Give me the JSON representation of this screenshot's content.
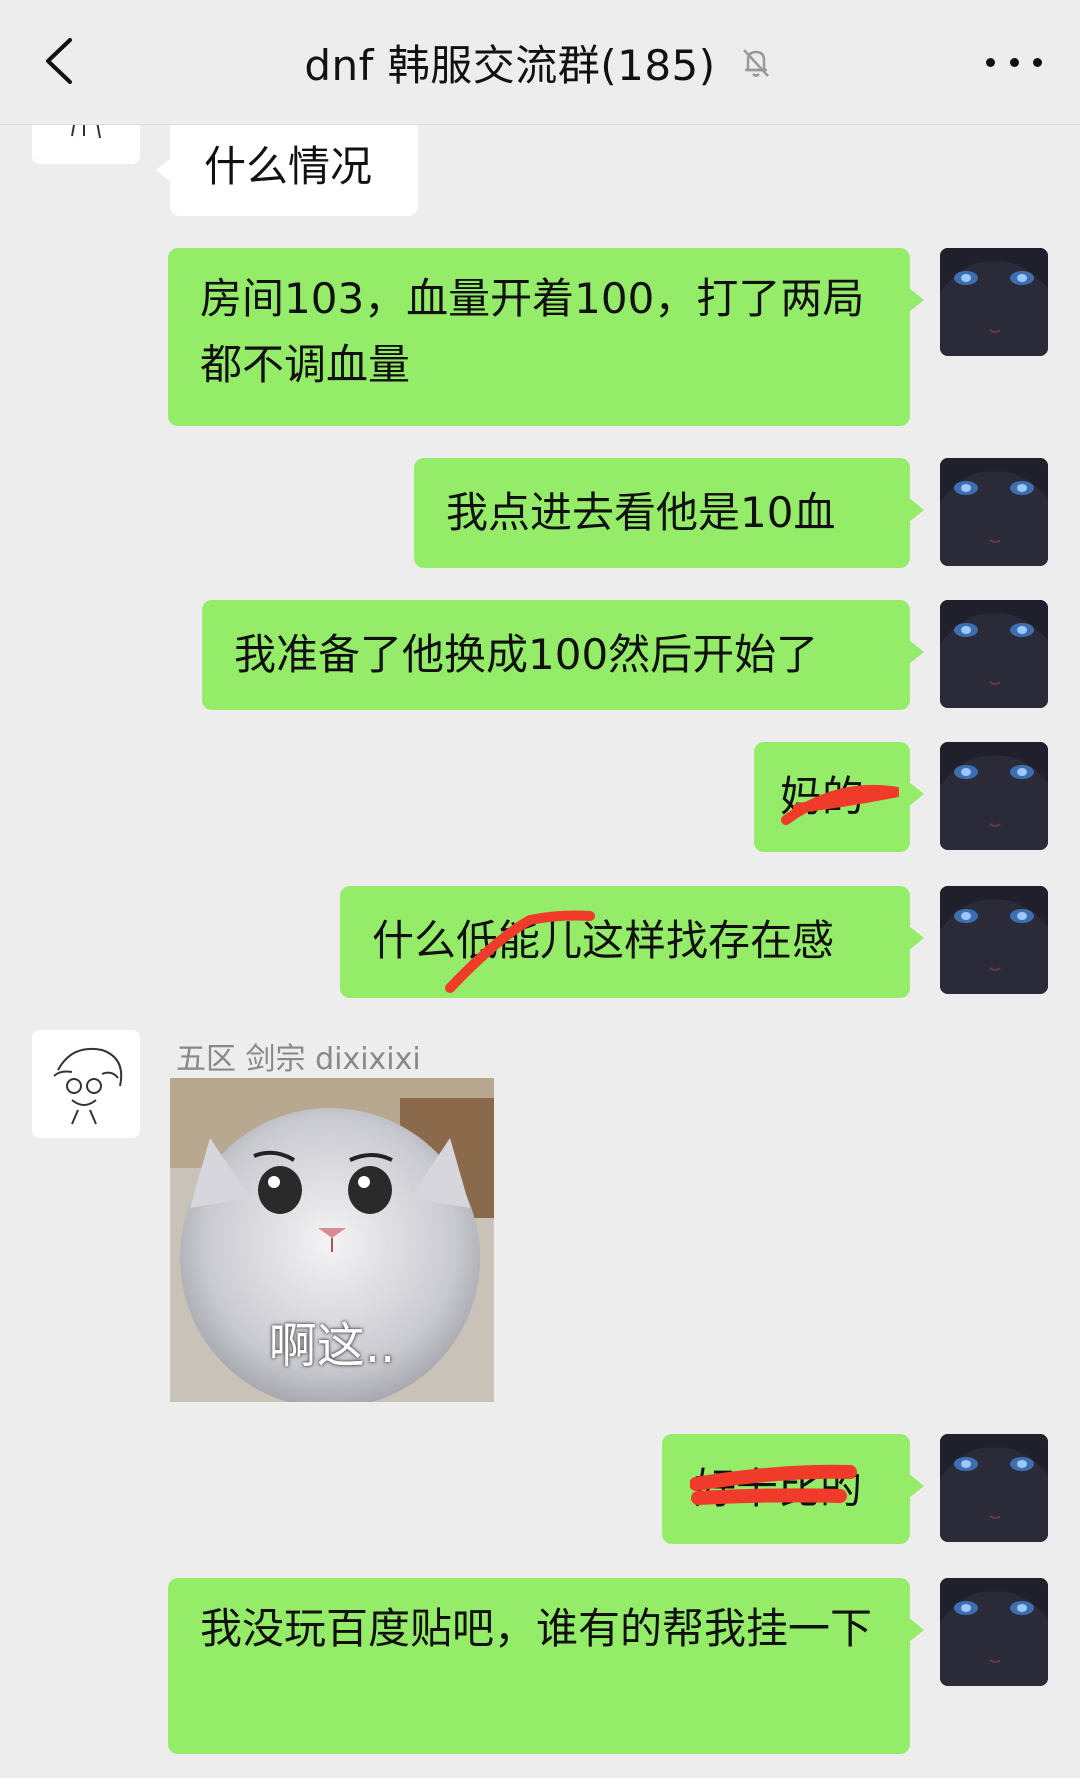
{
  "header": {
    "back_icon": "chevron-left-icon",
    "title": "dnf 韩服交流群(185)",
    "mute_icon": "bell-off-icon",
    "more_icon": "more-dots-icon"
  },
  "messages": [
    {
      "side": "other",
      "text": "什么情况"
    },
    {
      "side": "me",
      "text": "房间103，血量开着100，打了两局都不调血量"
    },
    {
      "side": "me",
      "text": "我点进去看他是10血"
    },
    {
      "side": "me",
      "text": "我准备了他换成100然后开始了"
    },
    {
      "side": "me",
      "text": "妈的",
      "redacted": true
    },
    {
      "side": "me",
      "text": "什么低能儿这样找存在感",
      "redacted": true
    },
    {
      "side": "other",
      "sender": "五区 剑宗 dixixixi",
      "type": "sticker",
      "sticker_text": "啊这.."
    },
    {
      "side": "me",
      "text": "好卡比的",
      "redacted": true
    },
    {
      "side": "me",
      "text": "我没玩百度贴吧，谁有的帮我挂一下"
    }
  ],
  "colors": {
    "my_bubble": "#95ec69",
    "other_bubble": "#ffffff",
    "background": "#ededed",
    "redaction": "#f03a2a"
  }
}
